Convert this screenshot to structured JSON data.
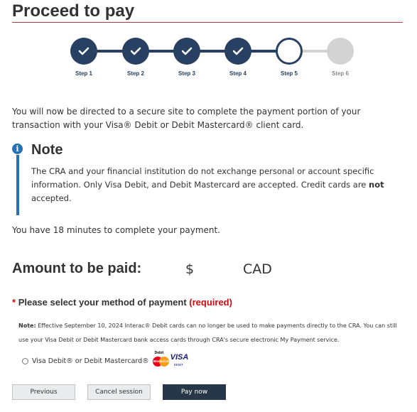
{
  "page": {
    "title": "Proceed to pay"
  },
  "stepper": {
    "steps": [
      {
        "label": "Step 1",
        "state": "complete"
      },
      {
        "label": "Step 2",
        "state": "complete"
      },
      {
        "label": "Step 3",
        "state": "complete"
      },
      {
        "label": "Step 4",
        "state": "complete"
      },
      {
        "label": "Step 5",
        "state": "current"
      },
      {
        "label": "Step 6",
        "state": "upcoming"
      }
    ],
    "colors": {
      "complete": "#284162",
      "upcoming": "#d3d3d3"
    }
  },
  "intro": "You will now be directed to a secure site to complete the payment portion of your transaction with your Visa® Debit or Debit Mastercard® client card.",
  "note": {
    "icon": "info-icon",
    "title": "Note",
    "body_start": "The CRA and your financial institution do not exchange personal or account specific information. Only Visa Debit, and Debit Mastercard are accepted. Credit cards are ",
    "body_bold": "not",
    "body_end": " accepted.",
    "accent_color": "#2572b4"
  },
  "time_notice": "You have 18 minutes to complete your payment.",
  "amount": {
    "label": "Amount to be paid:",
    "symbol": "$",
    "currency": "CAD"
  },
  "payment_method": {
    "asterisk": "*",
    "label": "Please select your method of payment",
    "required": "(required)",
    "required_color": "#d3080c"
  },
  "small_note": {
    "label": "Note:",
    "text": "Effective September 10, 2024 Interac® Debit cards can no longer be used to make payments directly to the CRA. You can still use your Visa Debit or Debit Mastercard bank access cards through CRA's secure electronic My Payment service."
  },
  "option": {
    "label": "Visa Debit® or Debit Mastercard®",
    "selected": false,
    "logos": {
      "mc_top": "Debit",
      "mc_word": "MasterCard",
      "visa_word": "VISA",
      "visa_sub": "DEBIT"
    }
  },
  "buttons": {
    "previous": "Previous",
    "cancel": "Cancel session",
    "pay": "Pay now",
    "primary_color": "#26374a"
  }
}
